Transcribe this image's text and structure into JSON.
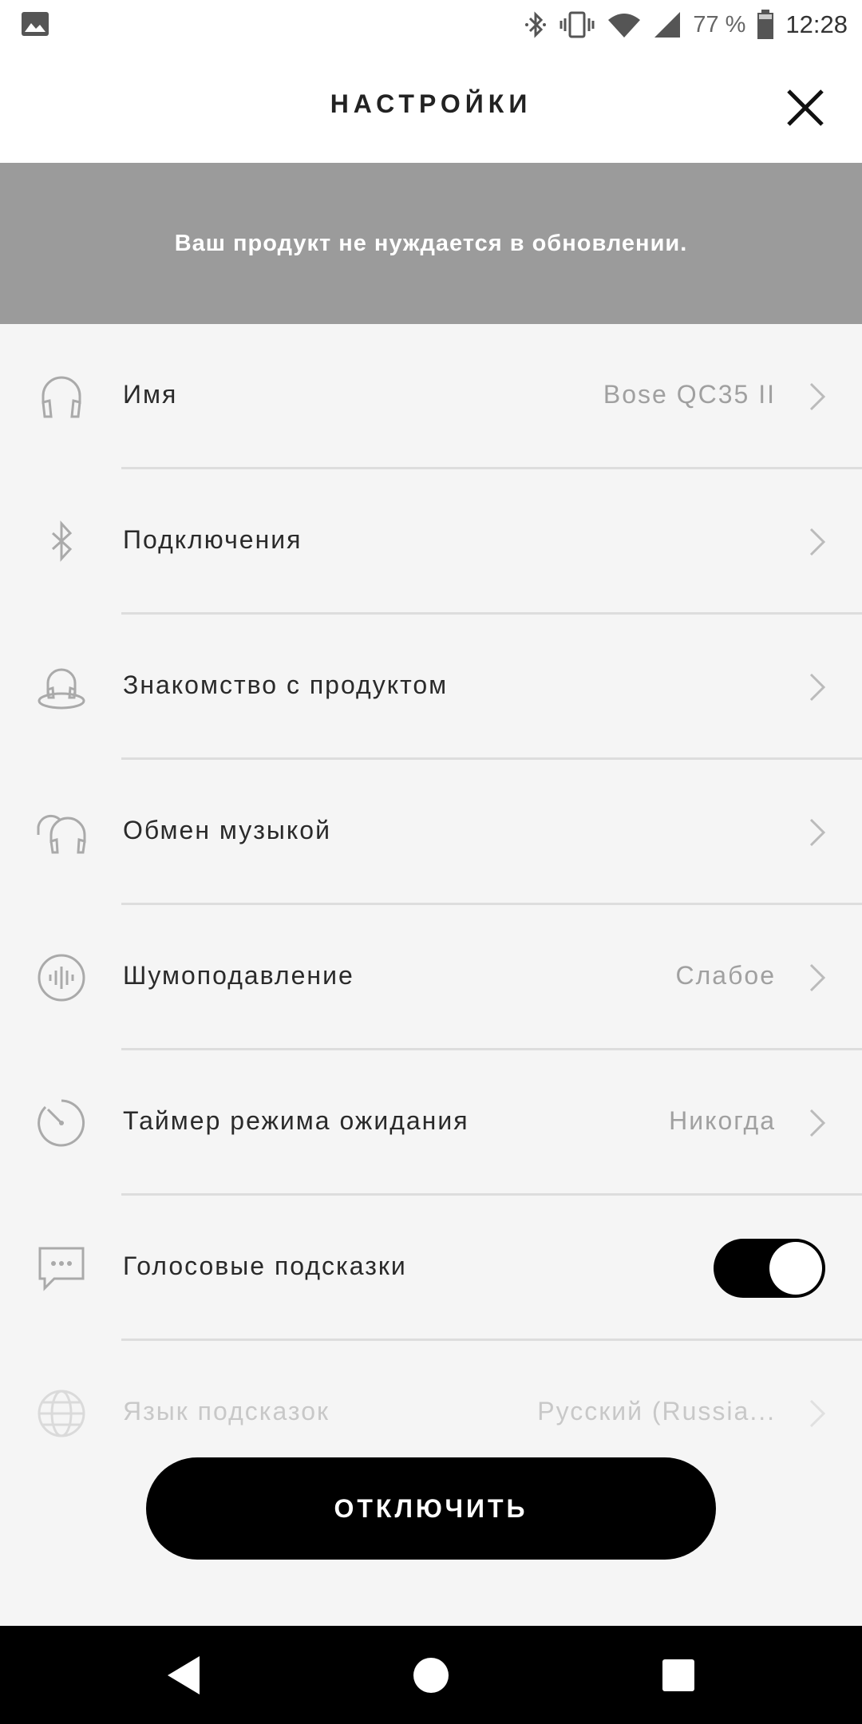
{
  "status_bar": {
    "left_icon": "image-icon",
    "icons": [
      "bluetooth-icon",
      "vibrate-icon",
      "wifi-icon",
      "signal-icon",
      "battery-icon"
    ],
    "battery": "77 %",
    "time": "12:28"
  },
  "header": {
    "title": "НАСТРОЙКИ",
    "close_icon": "close-icon"
  },
  "banner": {
    "text": "Ваш продукт не нуждается в обновлении."
  },
  "settings": [
    {
      "icon": "headphones-icon",
      "label": "Имя",
      "value": "Bose QC35 II"
    },
    {
      "icon": "bluetooth-icon",
      "label": "Подключения",
      "value": ""
    },
    {
      "icon": "headset-product-icon",
      "label": "Знакомство с продуктом",
      "value": ""
    },
    {
      "icon": "music-share-icon",
      "label": "Обмен музыкой",
      "value": ""
    },
    {
      "icon": "noise-cancel-icon",
      "label": "Шумоподавление",
      "value": "Слабое"
    },
    {
      "icon": "timer-icon",
      "label": "Таймер режима ожидания",
      "value": "Никогда"
    },
    {
      "icon": "chat-icon",
      "label": "Голосовые подсказки",
      "toggle": true
    },
    {
      "icon": "globe-icon",
      "label": "Язык подсказок",
      "value": "Русский (Russia..."
    }
  ],
  "disconnect_label": "ОТКЛЮЧИТЬ",
  "nav": {
    "back": "back-icon",
    "home": "home-icon",
    "recents": "recents-icon"
  }
}
